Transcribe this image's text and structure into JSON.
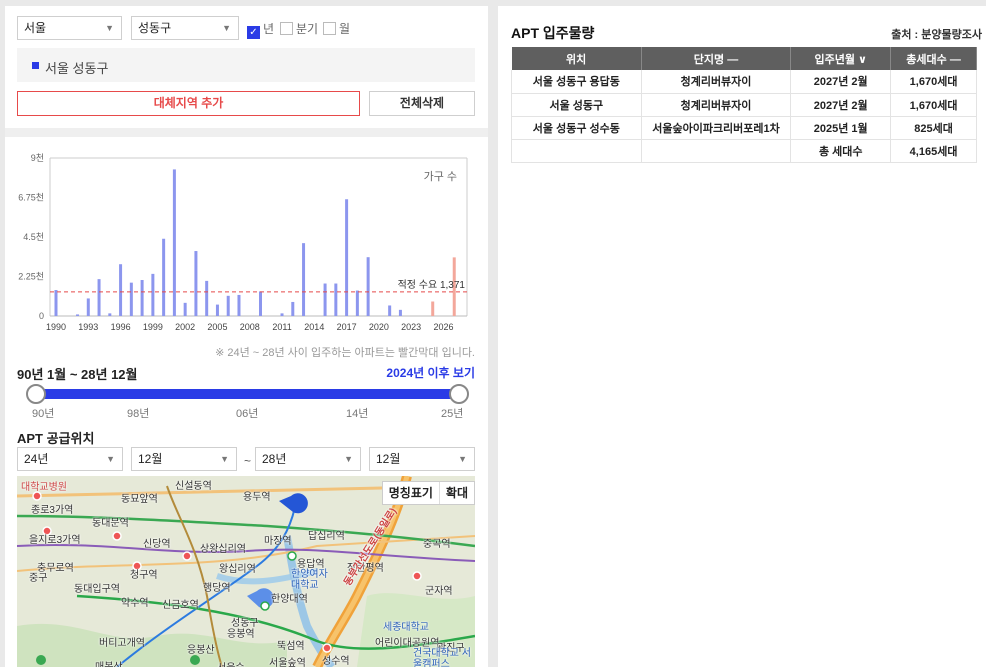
{
  "filters": {
    "city": "서울",
    "district": "성동구",
    "period_year": "년",
    "period_quarter": "분기",
    "period_month": "월"
  },
  "region_tag": "서울 성동구",
  "buttons": {
    "add_region": "대체지역 추가",
    "delete_all": "전체삭제"
  },
  "chart_data": {
    "type": "bar",
    "title": "",
    "xlabel": "",
    "ylabel": "",
    "legend_label": "가구 수",
    "y_ticks": [
      "0",
      "2.25천",
      "4.5천",
      "6.75천",
      "9천"
    ],
    "ylim": [
      0,
      9000
    ],
    "x_ticks": [
      "1990",
      "1993",
      "1996",
      "1999",
      "2002",
      "2005",
      "2008",
      "2011",
      "2014",
      "2017",
      "2020",
      "2023",
      "2026"
    ],
    "categories": [
      1990,
      1991,
      1992,
      1993,
      1994,
      1995,
      1996,
      1997,
      1998,
      1999,
      2000,
      2001,
      2002,
      2003,
      2004,
      2005,
      2006,
      2007,
      2008,
      2009,
      2010,
      2011,
      2012,
      2013,
      2014,
      2015,
      2016,
      2017,
      2018,
      2019,
      2020,
      2021,
      2022,
      2023,
      2024,
      2025,
      2026,
      2027
    ],
    "values": [
      1480,
      0,
      90,
      1000,
      2100,
      150,
      2950,
      1900,
      2050,
      2400,
      4400,
      8350,
      750,
      3700,
      2000,
      650,
      1150,
      1200,
      0,
      1400,
      0,
      150,
      800,
      4150,
      0,
      1850,
      1850,
      6650,
      1450,
      3350,
      0,
      600,
      350,
      0,
      0,
      825,
      0,
      3340
    ],
    "highlight_from": 2024,
    "reference_line": {
      "label": "적정 수요",
      "value": 1371,
      "value_label": "1,371"
    },
    "colors": {
      "normal": "#8c96ee",
      "highlight": "#f3a79b",
      "reference": "#e54a4a"
    }
  },
  "chart_note": "※ 24년 ~ 28년 사이 입주하는 아파트는 빨간막대 입니다.",
  "range": {
    "title": "90년 1월 ~ 28년 12월",
    "link": "2024년 이후 보기",
    "ticks": [
      "90년",
      "98년",
      "06년",
      "14년",
      "25년"
    ],
    "start_fraction": 0,
    "end_fraction": 1
  },
  "location": {
    "title": "APT 공급위치",
    "from_year": "24년",
    "from_month": "12월",
    "to_year": "28년",
    "to_month": "12월",
    "tilde": "~"
  },
  "map": {
    "btn_name": "명칭표기",
    "btn_zoom": "확대",
    "labels": [
      {
        "text": "대학교병원",
        "cls": "red"
      },
      {
        "text": "동묘앞역",
        "cls": ""
      },
      {
        "text": "신설동역",
        "cls": ""
      },
      {
        "text": "용두역",
        "cls": ""
      },
      {
        "text": "종로3가역",
        "cls": ""
      },
      {
        "text": "동대문역",
        "cls": ""
      },
      {
        "text": "을지로3가역",
        "cls": ""
      },
      {
        "text": "신당역",
        "cls": ""
      },
      {
        "text": "상왕십리역",
        "cls": ""
      },
      {
        "text": "마장역",
        "cls": ""
      },
      {
        "text": "답십리역",
        "cls": ""
      },
      {
        "text": "중곡역",
        "cls": ""
      },
      {
        "text": "충무로역",
        "cls": ""
      },
      {
        "text": "중구",
        "cls": ""
      },
      {
        "text": "청구역",
        "cls": ""
      },
      {
        "text": "왕십리역",
        "cls": ""
      },
      {
        "text": "용답역",
        "cls": ""
      },
      {
        "text": "장한평역",
        "cls": ""
      },
      {
        "text": "한양여자대학교",
        "cls": "blue"
      },
      {
        "text": "동대입구역",
        "cls": ""
      },
      {
        "text": "행당역",
        "cls": ""
      },
      {
        "text": "한양대역",
        "cls": ""
      },
      {
        "text": "군자역",
        "cls": ""
      },
      {
        "text": "약수역",
        "cls": ""
      },
      {
        "text": "신금호역",
        "cls": ""
      },
      {
        "text": "성동구",
        "cls": ""
      },
      {
        "text": "응봉역",
        "cls": ""
      },
      {
        "text": "세종대학교",
        "cls": "blue"
      },
      {
        "text": "버티고개역",
        "cls": ""
      },
      {
        "text": "뚝섬역",
        "cls": ""
      },
      {
        "text": "어린이대공원역",
        "cls": ""
      },
      {
        "text": "광진구",
        "cls": ""
      },
      {
        "text": "응봉산",
        "cls": ""
      },
      {
        "text": "성수역",
        "cls": ""
      },
      {
        "text": "건국대학교 서울캠퍼스",
        "cls": "blue"
      },
      {
        "text": "매봉산",
        "cls": ""
      },
      {
        "text": "서울숲",
        "cls": ""
      },
      {
        "text": "서울숲역",
        "cls": ""
      },
      {
        "text": "동부간선도로(동일로)",
        "cls": "red"
      }
    ]
  },
  "supply": {
    "title": "APT 입주물량",
    "source": "출처 : 분양물량조사",
    "headers": [
      "위치",
      "단지명 —",
      "입주년월 ∨",
      "총세대수 —"
    ],
    "rows": [
      [
        "서울 성동구 용답동",
        "청계리버뷰자이",
        "2027년 2월",
        "1,670세대"
      ],
      [
        "서울 성동구",
        "청계리버뷰자이",
        "2027년 2월",
        "1,670세대"
      ],
      [
        "서울 성동구 성수동",
        "서울숲아이파크리버포레1차",
        "2025년 1월",
        "825세대"
      ],
      [
        "",
        "",
        "총 세대수",
        "4,165세대"
      ]
    ]
  }
}
